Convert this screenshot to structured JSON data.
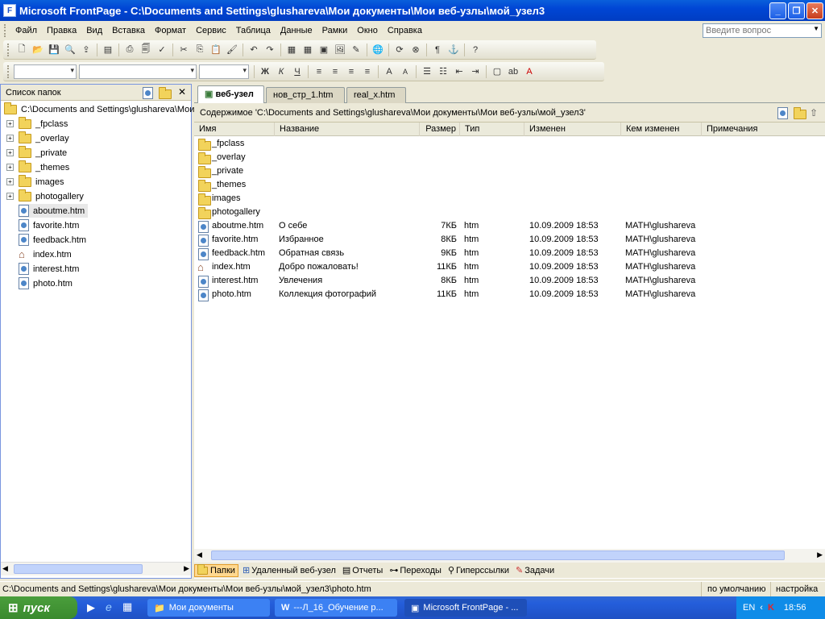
{
  "window": {
    "title": "Microsoft FrontPage - C:\\Documents and Settings\\glushareva\\Мои документы\\Мои веб-узлы\\мой_узел3"
  },
  "menu": [
    "Файл",
    "Правка",
    "Вид",
    "Вставка",
    "Формат",
    "Сервис",
    "Таблица",
    "Данные",
    "Рамки",
    "Окно",
    "Справка"
  ],
  "ask_placeholder": "Введите вопрос",
  "folder_list": {
    "title": "Список папок",
    "root": "C:\\Documents and Settings\\glushareva\\Мои ...",
    "folders": [
      "_fpclass",
      "_overlay",
      "_private",
      "_themes",
      "images",
      "photogallery"
    ],
    "files": [
      "aboutme.htm",
      "favorite.htm",
      "feedback.htm",
      "index.htm",
      "interest.htm",
      "photo.htm"
    ]
  },
  "tabs": [
    "веб-узел",
    "нов_стр_1.htm",
    "real_x.htm"
  ],
  "contents_path": "Содержимое 'C:\\Documents and Settings\\glushareva\\Мои документы\\Мои веб-узлы\\мой_узел3'",
  "columns": [
    "Имя",
    "Название",
    "Размер",
    "Тип",
    "Изменен",
    "Кем изменен",
    "Примечания"
  ],
  "folder_rows": [
    "_fpclass",
    "_overlay",
    "_private",
    "_themes",
    "images",
    "photogallery"
  ],
  "file_rows": [
    {
      "name": "aboutme.htm",
      "title": "О себе",
      "size": "7КБ",
      "type": "htm",
      "modified": "10.09.2009 18:53",
      "by": "MATH\\glushareva"
    },
    {
      "name": "favorite.htm",
      "title": "Избранное",
      "size": "8КБ",
      "type": "htm",
      "modified": "10.09.2009 18:53",
      "by": "MATH\\glushareva"
    },
    {
      "name": "feedback.htm",
      "title": "Обратная связь",
      "size": "9КБ",
      "type": "htm",
      "modified": "10.09.2009 18:53",
      "by": "MATH\\glushareva"
    },
    {
      "name": "index.htm",
      "title": "Добро пожаловать!",
      "size": "11КБ",
      "type": "htm",
      "modified": "10.09.2009 18:53",
      "by": "MATH\\glushareva"
    },
    {
      "name": "interest.htm",
      "title": "Увлечения",
      "size": "8КБ",
      "type": "htm",
      "modified": "10.09.2009 18:53",
      "by": "MATH\\glushareva"
    },
    {
      "name": "photo.htm",
      "title": "Коллекция фотографий",
      "size": "11КБ",
      "type": "htm",
      "modified": "10.09.2009 18:53",
      "by": "MATH\\glushareva"
    }
  ],
  "views": [
    "Папки",
    "Удаленный веб-узел",
    "Отчеты",
    "Переходы",
    "Гиперссылки",
    "Задачи"
  ],
  "status": {
    "path": "C:\\Documents and Settings\\glushareva\\Мои документы\\Мои веб-узлы\\мой_узел3\\photo.htm",
    "mode": "по умолчанию",
    "settings": "настройка"
  },
  "taskbar": {
    "start": "пуск",
    "tasks": [
      "Мои документы",
      "---Л_16_Обучение р...",
      "Microsoft FrontPage - ..."
    ],
    "lang": "EN",
    "time": "18:56"
  }
}
